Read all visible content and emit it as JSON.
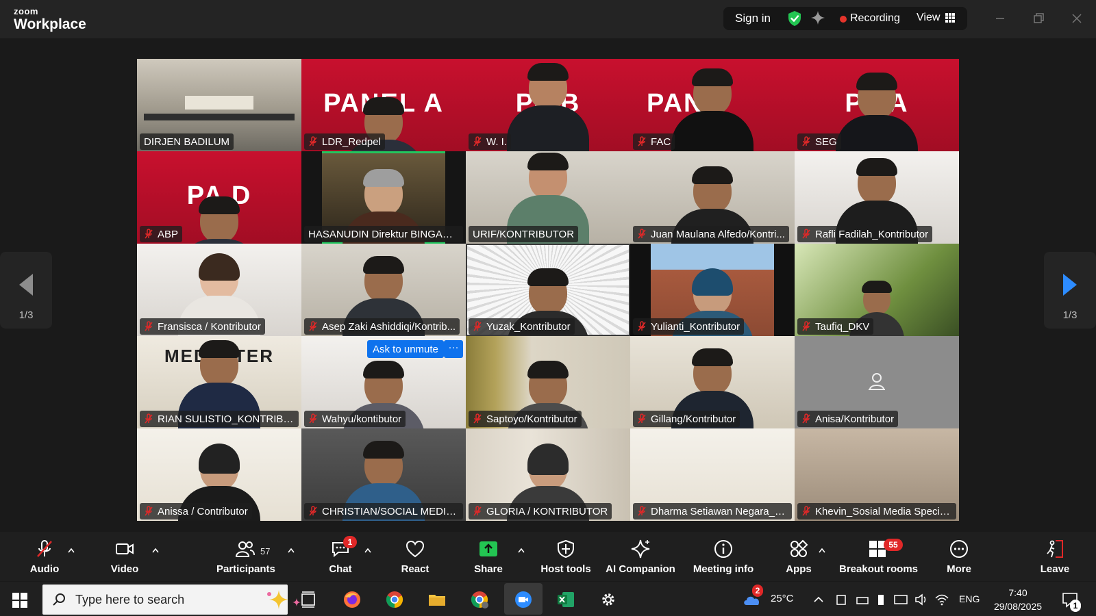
{
  "app": {
    "brand_small": "zoom",
    "brand_big": "Workplace"
  },
  "topbar": {
    "signin": "Sign in",
    "recording": "Recording",
    "view": "View"
  },
  "pager": {
    "left": "1/3",
    "right": "1/3"
  },
  "tiles": [
    {
      "name": "DIRJEN BADILUM",
      "panel": "",
      "muted": false
    },
    {
      "name": "LDR_Redpel",
      "panel": "PANEL A",
      "muted": true
    },
    {
      "name": "W. I.",
      "panel": "PA    B",
      "muted": true
    },
    {
      "name": "FAC",
      "panel": "PAN",
      "muted": true
    },
    {
      "name": "SEG",
      "panel": "PA    A",
      "muted": true
    },
    {
      "name": "ABP",
      "panel": "PA    D",
      "muted": true
    },
    {
      "name": "HASANUDIN Direktur BINGANIS",
      "panel": "",
      "muted": false
    },
    {
      "name": "URIF/KONTRIBUTOR",
      "panel": "",
      "muted": false
    },
    {
      "name": "Juan Maulana Alfedo/Kontri...",
      "panel": "",
      "muted": true
    },
    {
      "name": "Rafli Fadilah_Kontributor",
      "panel": "",
      "muted": true
    },
    {
      "name": "Fransisca / Kontributor",
      "panel": "",
      "muted": true
    },
    {
      "name": "Asep Zaki Ashiddiqi/Kontrib...",
      "panel": "",
      "muted": true
    },
    {
      "name": "Yuzak_Kontributor",
      "panel": "",
      "muted": true
    },
    {
      "name": "Yulianti_Kontributor",
      "panel": "",
      "muted": true
    },
    {
      "name": "Taufiq_DKV",
      "panel": "",
      "muted": true
    },
    {
      "name": "RIAN SULISTIO_KONTRIBUT...",
      "panel": "MEDIA    TER",
      "muted": true
    },
    {
      "name": "Wahyu/kontibutor",
      "panel": "",
      "muted": true
    },
    {
      "name": "Saptoyo/Kontributor",
      "panel": "",
      "muted": true
    },
    {
      "name": "Gillang/Kontributor",
      "panel": "",
      "muted": true
    },
    {
      "name": "Anisa/Kontributor",
      "panel": "",
      "muted": true
    },
    {
      "name": "Anissa / Contributor",
      "panel": "",
      "muted": true
    },
    {
      "name": "CHRISTIAN/SOCIAL MEDIA S...",
      "panel": "",
      "muted": true
    },
    {
      "name": "GLORIA / KONTRIBUTOR",
      "panel": "",
      "muted": true
    },
    {
      "name": "Dharma Setiawan Negara_K...",
      "panel": "",
      "muted": true
    },
    {
      "name": "Khevin_Sosial Media Special...",
      "panel": "",
      "muted": true
    }
  ],
  "hover": {
    "ask_unmute": "Ask to unmute",
    "more": "···"
  },
  "toolbar": {
    "audio": "Audio",
    "video": "Video",
    "participants": "Participants",
    "participants_count": "57",
    "chat": "Chat",
    "chat_badge": "1",
    "react": "React",
    "share": "Share",
    "host_tools": "Host tools",
    "ai_companion": "AI Companion",
    "meeting_info": "Meeting info",
    "apps": "Apps",
    "breakout": "Breakout rooms",
    "breakout_badge": "55",
    "more": "More",
    "leave": "Leave"
  },
  "taskbar": {
    "search_placeholder": "Type here to search",
    "weather_badge": "2",
    "temperature": "25°C",
    "language": "ENG",
    "time": "7:40",
    "date": "29/08/2025",
    "notif_count": "1"
  },
  "colors": {
    "accent_blue": "#0e72ed",
    "active_speaker": "#22c55e",
    "muted_red": "#e02828",
    "share_green": "#23c552"
  }
}
